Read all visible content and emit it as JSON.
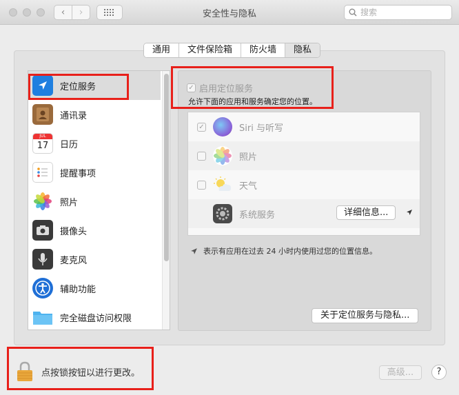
{
  "window": {
    "title": "安全性与隐私"
  },
  "search": {
    "placeholder": "搜索"
  },
  "tabs": [
    {
      "label": "通用",
      "active": false
    },
    {
      "label": "文件保险箱",
      "active": false
    },
    {
      "label": "防火墙",
      "active": false
    },
    {
      "label": "隐私",
      "active": true
    }
  ],
  "sidebar": {
    "items": [
      {
        "label": "定位服务",
        "icon": "location-arrow-icon",
        "selected": true
      },
      {
        "label": "通讯录",
        "icon": "contacts-icon"
      },
      {
        "label": "日历",
        "icon": "calendar-icon"
      },
      {
        "label": "提醒事项",
        "icon": "reminders-icon"
      },
      {
        "label": "照片",
        "icon": "photos-icon"
      },
      {
        "label": "摄像头",
        "icon": "camera-icon"
      },
      {
        "label": "麦克风",
        "icon": "microphone-icon"
      },
      {
        "label": "辅助功能",
        "icon": "accessibility-icon"
      },
      {
        "label": "完全磁盘访问权限",
        "icon": "folder-icon"
      }
    ],
    "calendar_month": "JUL",
    "calendar_day": "17"
  },
  "location": {
    "enable_label": "启用定位服务",
    "enable_checked": true,
    "description": "允许下面的应用和服务确定您的位置。",
    "apps": [
      {
        "name": "Siri 与听写",
        "checked": true,
        "icon": "siri-icon"
      },
      {
        "name": "照片",
        "checked": false,
        "icon": "photos-icon"
      },
      {
        "name": "天气",
        "checked": false,
        "icon": "weather-icon"
      },
      {
        "name": "系统服务",
        "checkbox": false,
        "icon": "system-gear-icon",
        "details_label": "详细信息..."
      }
    ],
    "legend_text": "表示有应用在过去 24 小时内使用过您的位置信息。",
    "about_label": "关于定位服务与隐私..."
  },
  "footer": {
    "lock_label": "点按锁按钮以进行更改。",
    "advanced_label": "高级...",
    "help_label": "?"
  },
  "colors": {
    "annotation": "#e8201a",
    "location_blue": "#1f7fe0"
  }
}
